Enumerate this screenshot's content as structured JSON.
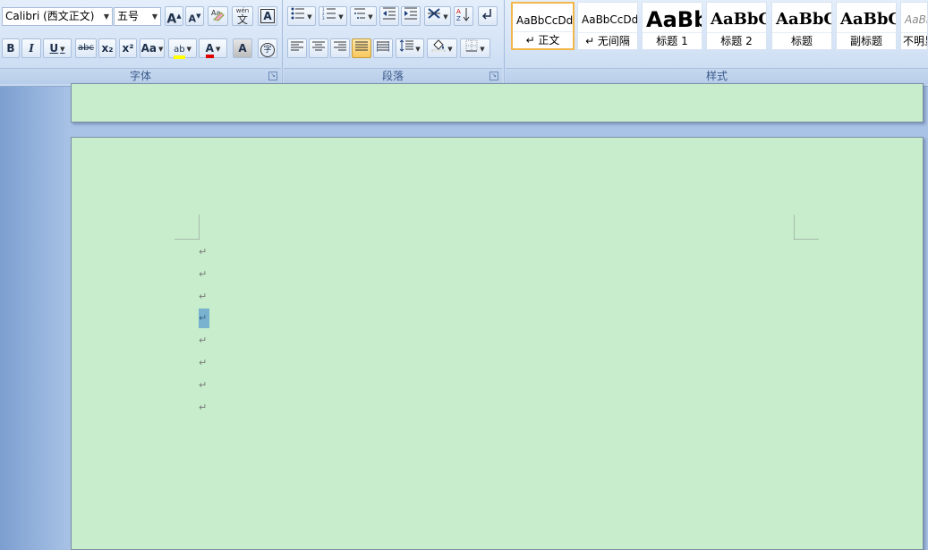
{
  "font_group": {
    "label": "字体",
    "font_name": "Calibri (西文正文)",
    "font_size": "五号",
    "buttons": {
      "grow": "A",
      "shrink": "A",
      "bold": "B",
      "italic": "I",
      "underline": "U",
      "strikethrough": "abc",
      "subscript": "x₂",
      "superscript": "x²",
      "change_case": "Aa",
      "highlight": "ab",
      "font_color": "A",
      "char_shading": "A",
      "enclose": "字",
      "wen": "wén",
      "wen_char": "文",
      "border": "A"
    },
    "colors": {
      "highlight": "#ffff00",
      "font_color": "#e00000"
    }
  },
  "paragraph_group": {
    "label": "段落"
  },
  "styles_group": {
    "label": "样式",
    "items": [
      {
        "sample": "AaBbCcDd",
        "name": "↵ 正文",
        "selected": true
      },
      {
        "sample": "AaBbCcDd",
        "name": "↵ 无间隔",
        "selected": false
      },
      {
        "sample": "AaBb",
        "name": "标题 1",
        "selected": false
      },
      {
        "sample": "AaBbC",
        "name": "标题 2",
        "selected": false
      },
      {
        "sample": "AaBbC",
        "name": "标题",
        "selected": false
      },
      {
        "sample": "AaBbC",
        "name": "副标题",
        "selected": false
      },
      {
        "sample": "AaBbC",
        "name": "不明显",
        "selected": false
      }
    ]
  },
  "document": {
    "page_color": "#c7edcc",
    "paragraph_mark": "↵",
    "paragraph_count": 8,
    "selected_paragraph": 4
  }
}
